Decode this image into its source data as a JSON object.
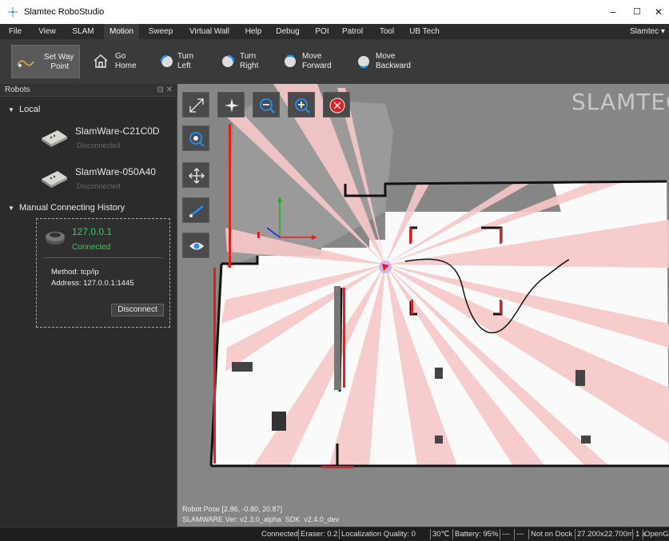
{
  "window": {
    "title": "Slamtec RoboStudio",
    "min": "–",
    "max": "☐",
    "close": "✕"
  },
  "menu": {
    "items": [
      "File",
      "View",
      "SLAM",
      "Motion",
      "Sweep",
      "Virtual Wall",
      "Help",
      "Debug",
      "POI",
      "Patrol",
      "Tool",
      "UB Tech"
    ],
    "active_index": 3,
    "user": "Slamtec ▾"
  },
  "toolbar": {
    "set_waypoint": "Set Way\n   Point",
    "go_home": "Go\nHome",
    "turn_left": "Turn\nLeft",
    "turn_right": "Turn\nRight",
    "move_forward": "Move\nForward",
    "move_backward": "Move\nBackward"
  },
  "panel": {
    "title": "Robots",
    "title_buttons": "⊟ ✕",
    "local_label": "Local",
    "robots": [
      {
        "name": "SlamWare-C21C0D",
        "status": "Disconnected"
      },
      {
        "name": "SlamWare-050A40",
        "status": "Disconnected"
      }
    ],
    "history_label": "Manual Connecting History",
    "connection": {
      "ip": "127.0.0.1",
      "status": "Connected",
      "method": "Method: tcp/ip",
      "address": "Address: 127.0.0.1:1445",
      "disconnect": "Disconnect"
    }
  },
  "map": {
    "brand": "SLAMTEC",
    "robot_pose": "Robot Pose [2.86, -0.80, 20.87]",
    "version": "SLAMWARE Ver: v2.3.0_alpha  SDK  v2.4.0_dev"
  },
  "status": {
    "connected": "Connected",
    "eraser": "Eraser: 0.2",
    "localization": "Localization Quality: 0",
    "temp": "30℃",
    "battery": "Battery: 95%",
    "d1": "---",
    "d2": "---",
    "dock": "Not on Dock",
    "size": "27.200x22.700m",
    "zoom": "1 x",
    "renderer": "OpenGL"
  }
}
